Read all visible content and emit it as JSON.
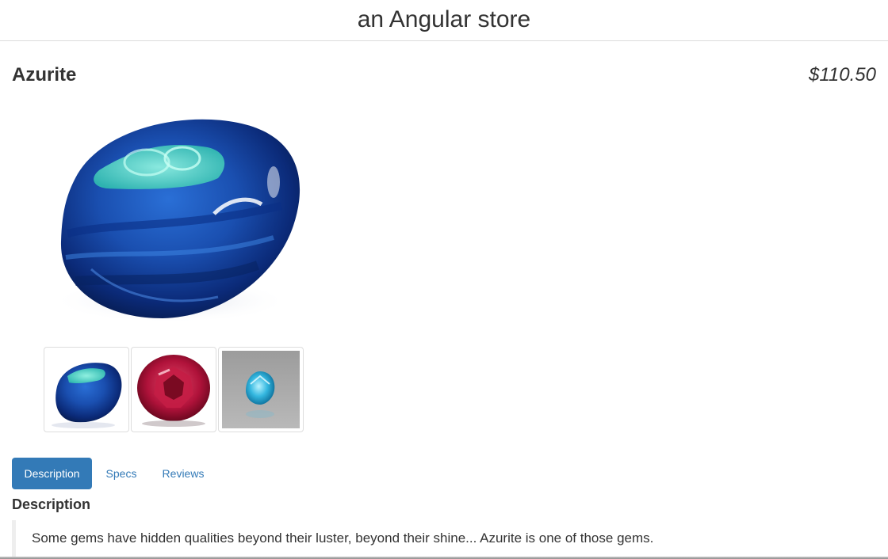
{
  "header": {
    "title": "an Angular store"
  },
  "product": {
    "name": "Azurite",
    "price": "$110.50",
    "main_image": "azurite-gem",
    "thumbnails": [
      {
        "name": "azurite-gem",
        "selected": true
      },
      {
        "name": "red-garnet-gem",
        "selected": false
      },
      {
        "name": "blue-zircon-gem",
        "selected": false
      }
    ]
  },
  "tabs": [
    {
      "label": "Description",
      "active": true
    },
    {
      "label": "Specs",
      "active": false
    },
    {
      "label": "Reviews",
      "active": false
    }
  ],
  "description": {
    "heading": "Description",
    "text": "Some gems have hidden qualities beyond their luster, beyond their shine... Azurite is one of those gems."
  },
  "colors": {
    "accent": "#337ab7",
    "text": "#333333"
  }
}
